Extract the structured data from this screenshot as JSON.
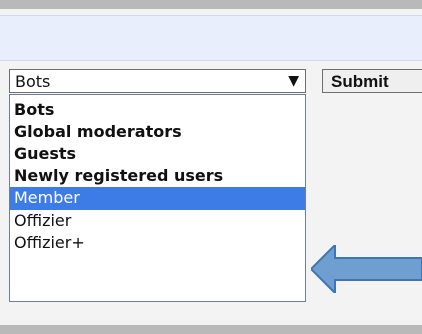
{
  "form": {
    "select_value": "Bots",
    "submit_label": "Submit"
  },
  "dropdown": {
    "options": [
      {
        "label": "Bots",
        "style": "bold"
      },
      {
        "label": "Global moderators",
        "style": "bold"
      },
      {
        "label": "Guests",
        "style": "bold"
      },
      {
        "label": "Newly registered users",
        "style": "bold"
      },
      {
        "label": "Member",
        "style": "selected"
      },
      {
        "label": "Offizier",
        "style": "normal"
      },
      {
        "label": "Offizier+",
        "style": "normal"
      }
    ]
  },
  "colors": {
    "highlight": "#3d7be6",
    "arrow_fill": "#6e9fd0"
  }
}
